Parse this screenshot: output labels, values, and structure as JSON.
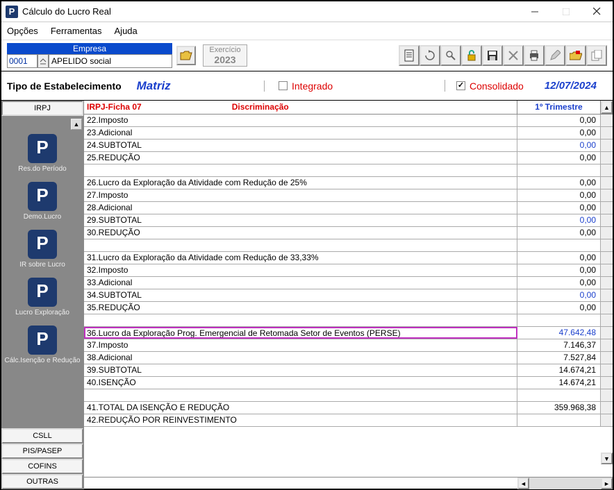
{
  "window": {
    "title": "Cálculo do Lucro Real"
  },
  "menu": {
    "opcoes": "Opções",
    "ferramentas": "Ferramentas",
    "ajuda": "Ajuda"
  },
  "empresa": {
    "header": "Empresa",
    "code": "0001",
    "name": "APELIDO social"
  },
  "exercicio": {
    "label": "Exercício",
    "year": "2023"
  },
  "header": {
    "tipo_label": "Tipo de Estabelecimento",
    "matriz": "Matriz",
    "integrado": "Integrado",
    "consolidado": "Consolidado",
    "date": "12/07/2024"
  },
  "sidebar": {
    "top_tab": "IRPJ",
    "items": [
      {
        "label": "Res.do Período"
      },
      {
        "label": "Demo.Lucro"
      },
      {
        "label": "IR sobre Lucro"
      },
      {
        "label": "Lucro Exploração"
      },
      {
        "label": "Cálc.Isenção e Redução"
      }
    ],
    "bottom_tabs": [
      "CSLL",
      "PIS/PASEP",
      "COFINS",
      "OUTRAS"
    ]
  },
  "grid": {
    "header_ficha": "IRPJ-Ficha  07",
    "header_disc": "Discriminação",
    "header_val": "1º Trimestre",
    "rows": [
      {
        "disc": "22.Imposto",
        "val": "0,00"
      },
      {
        "disc": "23.Adicional",
        "val": "0,00"
      },
      {
        "disc": "24.SUBTOTAL",
        "val": "0,00",
        "subtotal": true
      },
      {
        "disc": "25.REDUÇÃO",
        "val": "0,00"
      },
      {
        "spacer": true
      },
      {
        "disc": "26.Lucro da Exploração da Atividade com Redução de 25%",
        "val": "0,00"
      },
      {
        "disc": "27.Imposto",
        "val": "0,00"
      },
      {
        "disc": "28.Adicional",
        "val": "0,00"
      },
      {
        "disc": "29.SUBTOTAL",
        "val": "0,00",
        "subtotal": true
      },
      {
        "disc": "30.REDUÇÃO",
        "val": "0,00"
      },
      {
        "spacer": true
      },
      {
        "disc": "31.Lucro da Exploração da Atividade com Redução de 33,33%",
        "val": "0,00"
      },
      {
        "disc": "32.Imposto",
        "val": "0,00"
      },
      {
        "disc": "33.Adicional",
        "val": "0,00"
      },
      {
        "disc": "34.SUBTOTAL",
        "val": "0,00",
        "subtotal": true
      },
      {
        "disc": "35.REDUÇÃO",
        "val": "0,00"
      },
      {
        "spacer": true
      },
      {
        "disc": "36.Lucro da Exploração Prog. Emergencial de Retomada Setor de Eventos (PERSE)",
        "val": "47.642,48",
        "highlight": true
      },
      {
        "disc": "37.Imposto",
        "val": "7.146,37"
      },
      {
        "disc": "38.Adicional",
        "val": "7.527,84"
      },
      {
        "disc": "39.SUBTOTAL",
        "val": "14.674,21"
      },
      {
        "disc": "40.ISENÇÃO",
        "val": "14.674,21"
      },
      {
        "spacer": true
      },
      {
        "disc": "41.TOTAL DA ISENÇÃO E REDUÇÃO",
        "val": "359.968,38"
      },
      {
        "disc": "42.REDUÇÃO POR REINVESTIMENTO",
        "val": ""
      }
    ]
  }
}
